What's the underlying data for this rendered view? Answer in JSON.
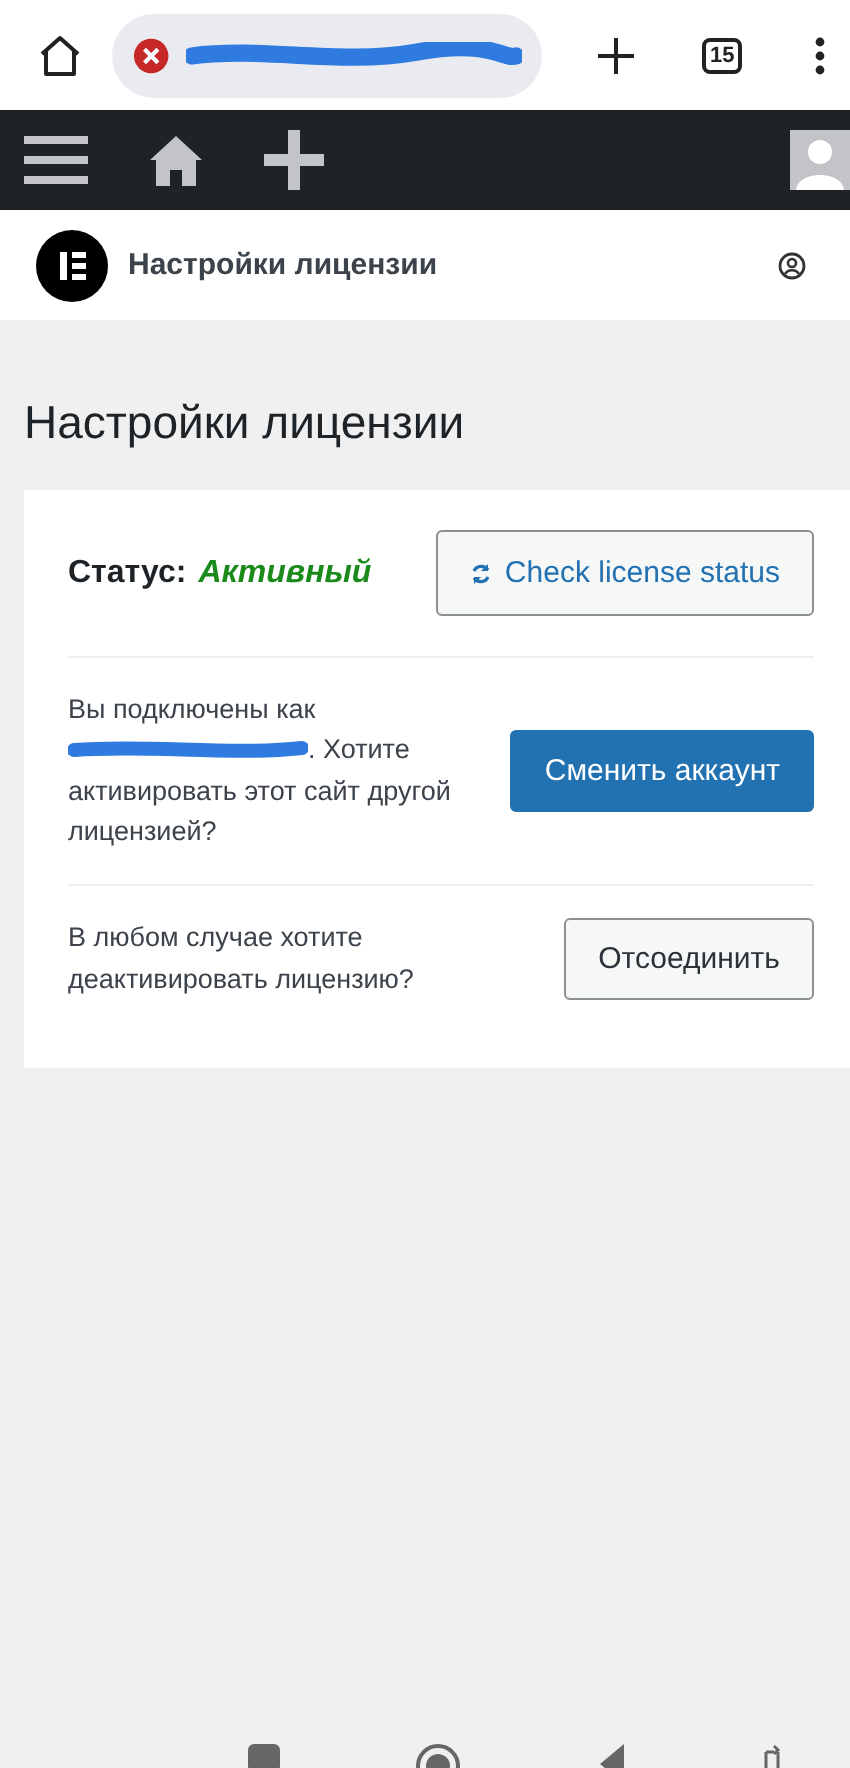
{
  "browser": {
    "tab_count": "15"
  },
  "header": {
    "title": "Настройки лицензии"
  },
  "page": {
    "title": "Настройки лицензии"
  },
  "status": {
    "label": "Статус:",
    "value": "Активный",
    "check_button": "Check license status"
  },
  "rows": [
    {
      "text_before": "Вы подключены как",
      "text_after": ". Хотите",
      "text_end": "активировать этот сайт другой лицензией?",
      "button": "Сменить аккаунт",
      "kind": "primary"
    },
    {
      "text_before": "В любом случае хотите деактивировать лицензию?",
      "button": "Отсоединить",
      "kind": "secondary"
    }
  ]
}
